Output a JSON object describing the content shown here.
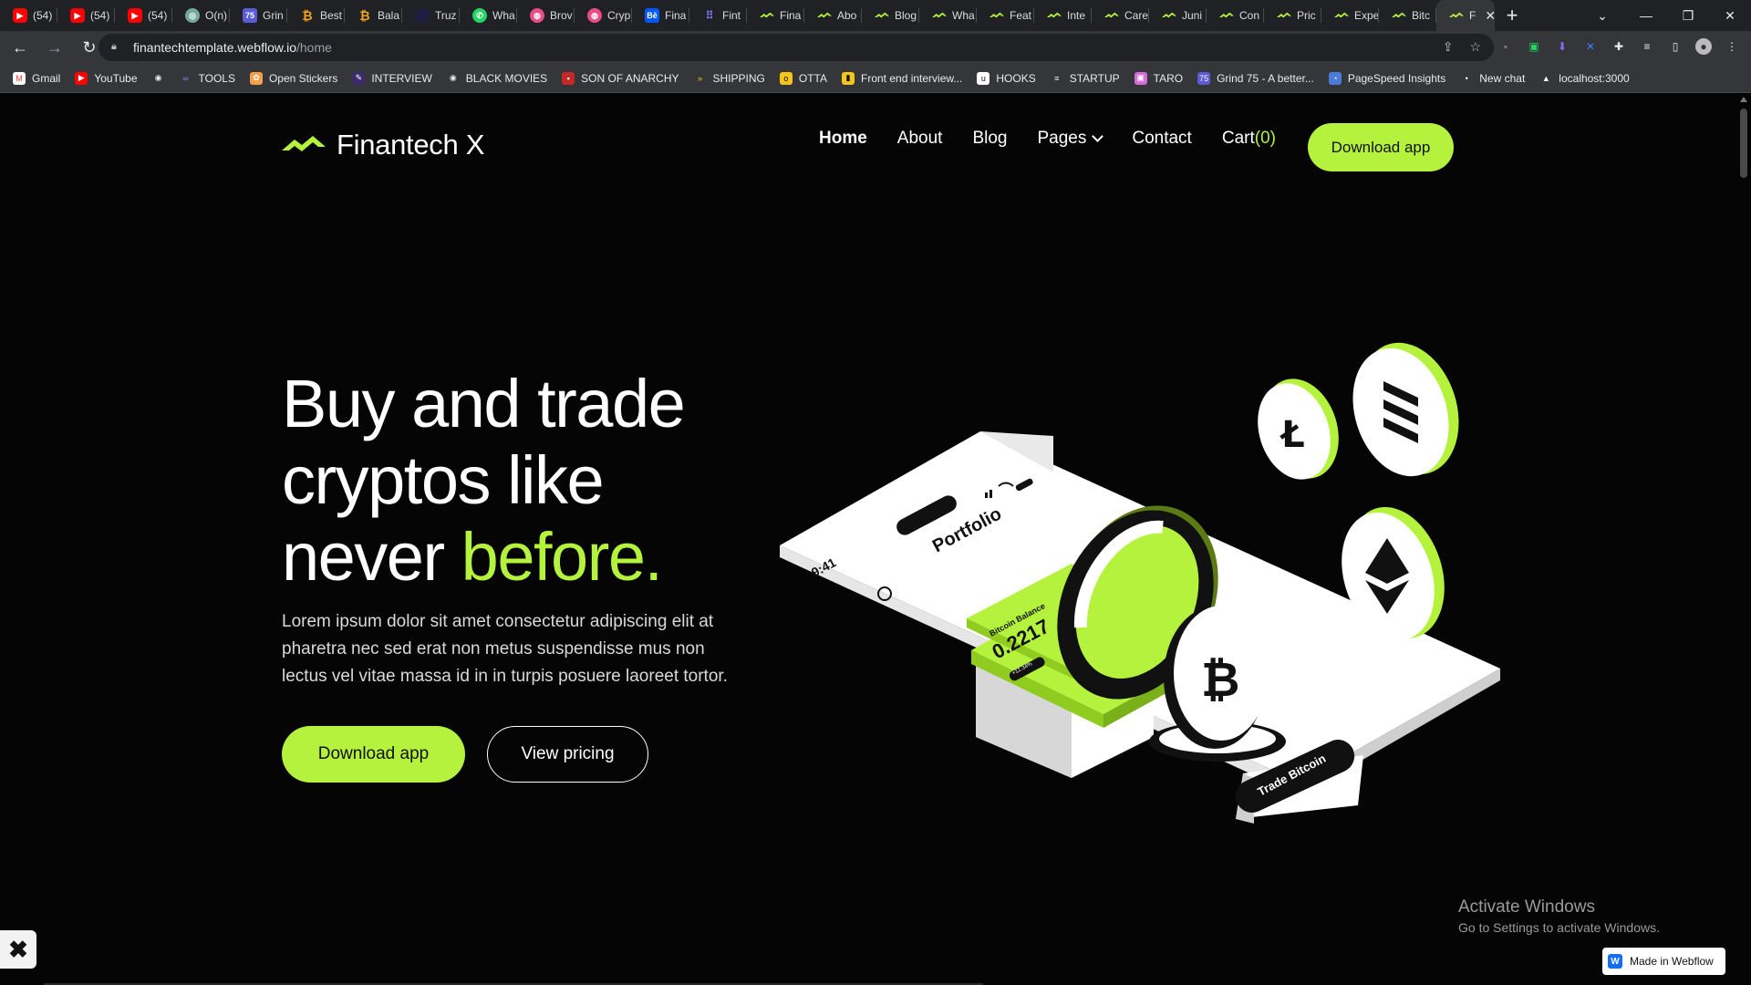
{
  "browser": {
    "tabs": [
      {
        "label": "(54)",
        "icon": "youtube-icon"
      },
      {
        "label": "(54)",
        "icon": "youtube-icon"
      },
      {
        "label": "(54)",
        "icon": "youtube-icon"
      },
      {
        "label": "O(n)",
        "icon": "chatgpt-icon"
      },
      {
        "label": "Grin",
        "icon": "grind75-icon"
      },
      {
        "label": "Best",
        "icon": "bitcoin-icon"
      },
      {
        "label": "Bala",
        "icon": "bitcoin-icon"
      },
      {
        "label": "Truz",
        "icon": "truz-icon"
      },
      {
        "label": "Wha",
        "icon": "whatsapp-icon"
      },
      {
        "label": "Brov",
        "icon": "dribbble-icon"
      },
      {
        "label": "Cryp",
        "icon": "dribbble-icon"
      },
      {
        "label": "Fina",
        "icon": "behance-icon"
      },
      {
        "label": "Fint",
        "icon": "dots-icon"
      },
      {
        "label": "Fina",
        "icon": "finantech-icon"
      },
      {
        "label": "Abo",
        "icon": "finantech-icon"
      },
      {
        "label": "Blog",
        "icon": "finantech-icon"
      },
      {
        "label": "Wha",
        "icon": "finantech-icon"
      },
      {
        "label": "Feat",
        "icon": "finantech-icon"
      },
      {
        "label": "Inte",
        "icon": "finantech-icon"
      },
      {
        "label": "Care",
        "icon": "finantech-icon"
      },
      {
        "label": "Juni",
        "icon": "finantech-icon"
      },
      {
        "label": "Con",
        "icon": "finantech-icon"
      },
      {
        "label": "Pric",
        "icon": "finantech-icon"
      },
      {
        "label": "Expe",
        "icon": "finantech-icon"
      },
      {
        "label": "Bitc",
        "icon": "finantech-icon"
      },
      {
        "label": "F",
        "icon": "finantech-icon",
        "active": true
      }
    ],
    "url_host": "finantechtemplate.webflow.io",
    "url_path": "/home",
    "bookmarks": [
      {
        "label": "Gmail",
        "icon": "gmail-icon"
      },
      {
        "label": "YouTube",
        "icon": "youtube-icon"
      },
      {
        "label": "",
        "icon": "globe-icon"
      },
      {
        "label": "TOOLS",
        "icon": "tools-icon"
      },
      {
        "label": "Open Stickers",
        "icon": "stickers-icon"
      },
      {
        "label": "INTERVIEW",
        "icon": "interview-icon"
      },
      {
        "label": "BLACK MOVIES",
        "icon": "globe-icon"
      },
      {
        "label": "SON OF ANARCHY",
        "icon": "soa-icon"
      },
      {
        "label": "SHIPPING",
        "icon": "shipping-icon"
      },
      {
        "label": "OTTA",
        "icon": "otta-icon"
      },
      {
        "label": "Front end interview...",
        "icon": "bookmark-icon"
      },
      {
        "label": "HOOKS",
        "icon": "hooks-icon"
      },
      {
        "label": "STARTUP",
        "icon": "startup-icon"
      },
      {
        "label": "TARO",
        "icon": "taro-icon"
      },
      {
        "label": "Grind 75 - A better...",
        "icon": "grind75-icon"
      },
      {
        "label": "PageSpeed Insights",
        "icon": "pagespeed-icon"
      },
      {
        "label": "New chat",
        "icon": "chatgpt-icon"
      },
      {
        "label": "localhost:3000",
        "icon": "vercel-icon"
      }
    ]
  },
  "site": {
    "logo_text": "Finantech X",
    "nav": {
      "home": "Home",
      "about": "About",
      "blog": "Blog",
      "pages": "Pages",
      "contact": "Contact",
      "cart": "Cart",
      "cart_count": "(0)",
      "cta": "Download app"
    },
    "hero": {
      "title_line1": "Buy and trade",
      "title_line2": "cryptos like",
      "title_line3_start": "never ",
      "title_highlight": "before.",
      "subtitle": "Lorem ipsum dolor sit amet consectetur adipiscing elit at pharetra nec sed erat non metus suspendisse mus non lectus vel vitae massa id in in turpis posuere laoreet tortor.",
      "primary_button": "Download app",
      "secondary_button": "View pricing"
    },
    "illustration": {
      "phone_time": "9:41",
      "phone_title": "Portfolio",
      "card_label": "Bitcoin Balance",
      "card_value": "0.2217",
      "card_badge": "+12.34%",
      "trade_label": "Trade Bitcoin"
    },
    "accent_color": "#b5f23d"
  },
  "overlay": {
    "activate_title": "Activate Windows",
    "activate_sub": "Go to Settings to activate Windows.",
    "webflow_badge": "Made in Webflow"
  }
}
